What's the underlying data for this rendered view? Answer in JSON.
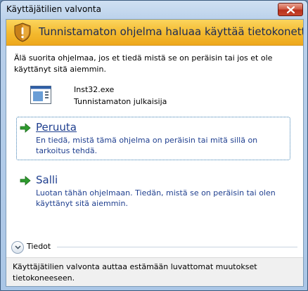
{
  "window": {
    "title": "Käyttäjätilien valvonta",
    "close_icon": "close-icon"
  },
  "banner": {
    "icon": "shield-warning-icon",
    "text": "Tunnistamaton ohjelma haluaa käyttää tietokonetta",
    "color": "#f3b92e"
  },
  "instruction": "Älä suorita ohjelmaa, jos et tiedä mistä se on peräisin tai jos et ole käyttänyt sitä aiemmin.",
  "program": {
    "icon": "program-icon",
    "name": "Inst32.exe",
    "publisher": "Tunnistamaton julkaisija"
  },
  "options": [
    {
      "icon": "green-arrow-icon",
      "title": "Peruuta",
      "description": "En tiedä, mistä tämä ohjelma on peräisin tai mitä sillä on tarkoitus tehdä.",
      "focused": true
    },
    {
      "icon": "green-arrow-icon",
      "title": "Salli",
      "description": "Luotan tähän ohjelmaan. Tiedän, mistä se on peräisin tai olen käyttänyt sitä aiemmin.",
      "focused": false
    }
  ],
  "details": {
    "icon": "chevron-down-icon",
    "label": "Tiedot"
  },
  "footer": {
    "text": "Käyttäjätilien valvonta auttaa estämään luvattomat muutokset tietokoneeseen."
  },
  "colors": {
    "link_text": "#1f3f8f",
    "arrow_green": "#2e9b2e",
    "frame": "#aac6e6"
  }
}
